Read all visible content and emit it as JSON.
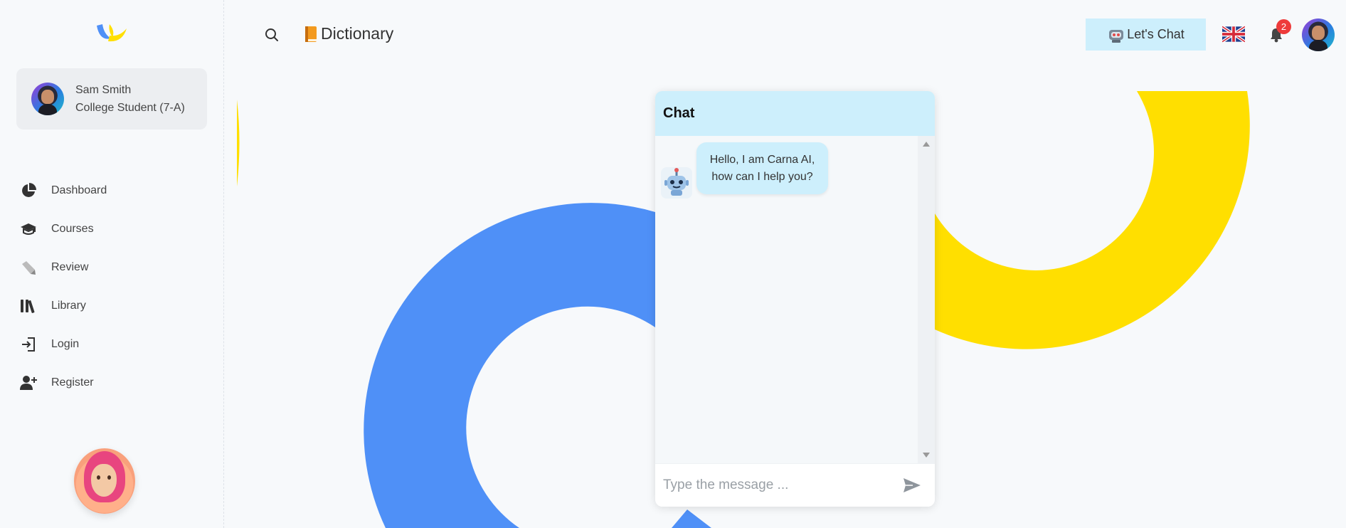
{
  "profile": {
    "name": "Sam Smith",
    "role": "College Student (7-A)"
  },
  "sidebar": {
    "items": [
      {
        "label": "Dashboard",
        "icon": "pie-chart-icon"
      },
      {
        "label": "Courses",
        "icon": "graduation-cap-icon"
      },
      {
        "label": "Review",
        "icon": "review-icon"
      },
      {
        "label": "Library",
        "icon": "books-icon"
      },
      {
        "label": "Login",
        "icon": "login-icon"
      },
      {
        "label": "Register",
        "icon": "user-plus-icon"
      }
    ]
  },
  "header": {
    "title": "Dictionary",
    "lets_chat_label": "Let's Chat",
    "notification_count": "2"
  },
  "chat": {
    "title": "Chat",
    "messages": [
      {
        "from": "bot",
        "text": "Hello, I am Carna AI, how can I help you?"
      }
    ],
    "input_placeholder": "Type the message ..."
  },
  "colors": {
    "accent_light_blue": "#cdeffc",
    "deco_blue": "#4f90f7",
    "deco_yellow": "#ffdf00",
    "badge_red": "#ee3b3b"
  }
}
